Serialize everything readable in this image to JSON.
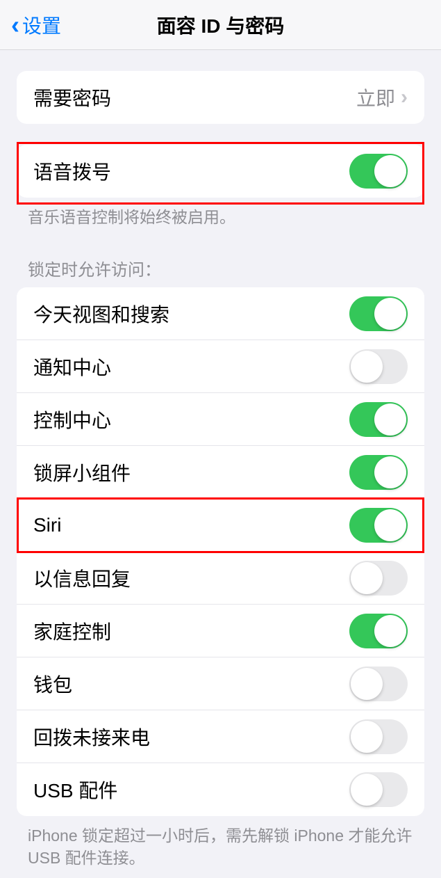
{
  "header": {
    "back_label": "设置",
    "title": "面容 ID 与密码"
  },
  "passcode": {
    "label": "需要密码",
    "value": "立即"
  },
  "voice_dial": {
    "label": "语音拨号",
    "on": true,
    "footer": "音乐语音控制将始终被启用。"
  },
  "allow_access": {
    "header": "锁定时允许访问：",
    "items": [
      {
        "label": "今天视图和搜索",
        "on": true
      },
      {
        "label": "通知中心",
        "on": false
      },
      {
        "label": "控制中心",
        "on": true
      },
      {
        "label": "锁屏小组件",
        "on": true
      },
      {
        "label": "Siri",
        "on": true
      },
      {
        "label": "以信息回复",
        "on": false
      },
      {
        "label": "家庭控制",
        "on": true
      },
      {
        "label": "钱包",
        "on": false
      },
      {
        "label": "回拨未接来电",
        "on": false
      },
      {
        "label": "USB 配件",
        "on": false
      }
    ],
    "footer": "iPhone 锁定超过一小时后，需先解锁 iPhone 才能允许 USB 配件连接。"
  }
}
